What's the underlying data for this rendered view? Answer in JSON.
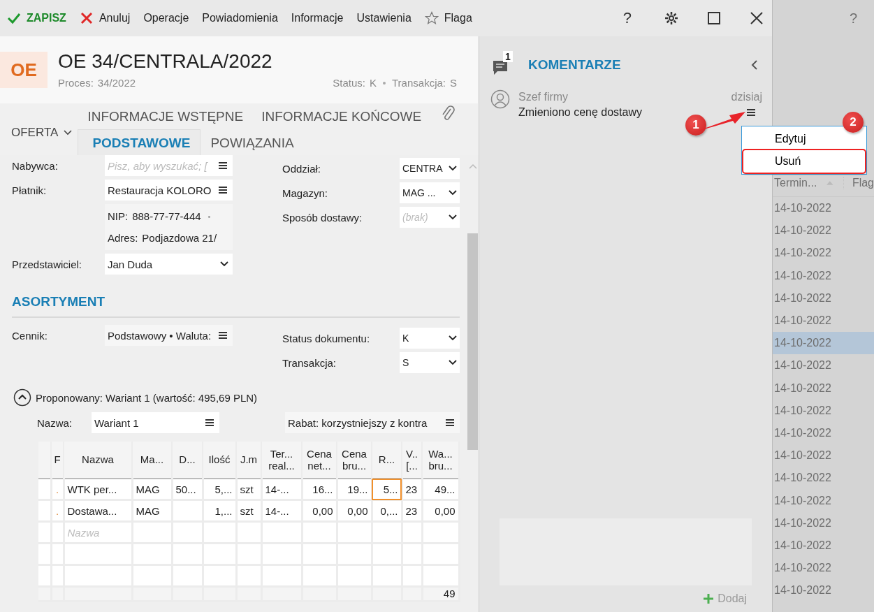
{
  "toolbar": {
    "items": [
      {
        "kind": "save",
        "label": "ZAPISZ"
      },
      {
        "kind": "cancel",
        "label": "Anuluj"
      },
      {
        "kind": "plain",
        "label": "Operacje"
      },
      {
        "kind": "plain",
        "label": "Powiadomienia"
      },
      {
        "kind": "plain",
        "label": "Informacje"
      },
      {
        "kind": "plain",
        "label": "Ustawienia"
      },
      {
        "kind": "flag",
        "label": "Flaga"
      }
    ],
    "help": "?"
  },
  "header": {
    "badge": "OE",
    "title": "OE 34/CENTRALA/2022",
    "process_label": "Proces:",
    "process": "34/2022",
    "status_label": "Status:",
    "status": "K",
    "transaction_label": "Transakcja:",
    "transaction": "S"
  },
  "document_type": "OFERTA",
  "tabs_top": [
    {
      "label": "INFORMACJE WSTĘPNE",
      "selected": false
    },
    {
      "label": "INFORMACJE KOŃCOWE",
      "selected": false
    }
  ],
  "tabs": [
    {
      "label": "PODSTAWOWE",
      "selected": true
    },
    {
      "label": "POWIĄZANIA",
      "selected": false
    }
  ],
  "fields_left": [
    {
      "kind": "menu",
      "label": "Nabywca:",
      "placeholder": "Pisz, aby wyszukać; ["
    },
    {
      "kind": "menu",
      "label": "Płatnik:",
      "value": "Restauracja KOLORO"
    },
    {
      "kind": "info",
      "lines": [
        {
          "label": "NIP:",
          "value": "888-77-77-444",
          "dot": "•"
        },
        {
          "label": "Adres:",
          "value": "Podjazdowa  21/"
        }
      ]
    },
    {
      "kind": "select",
      "label": "Przedstawiciel:",
      "value": "Jan Duda"
    }
  ],
  "fields_right": [
    {
      "kind": "select",
      "label": "Oddział:",
      "value": "CENTRA"
    },
    {
      "kind": "select",
      "label": "Magazyn:",
      "value": "MAG ..."
    },
    {
      "kind": "select",
      "label": "Sposób dostawy:",
      "placeholder": "(brak)"
    }
  ],
  "assortment": {
    "title": "ASORTYMENT",
    "price_list_label": "Cennik:",
    "price_list": "Podstawowy • Waluta:",
    "fields_right": [
      {
        "kind": "select",
        "label": "Status dokumentu:",
        "value": "K"
      },
      {
        "kind": "select",
        "label": "Transakcja:",
        "value": "S"
      }
    ],
    "variant": {
      "expanded": true,
      "summary": "Proponowany: Wariant 1 (wartość: 495,69 PLN)",
      "name_label": "Nazwa:",
      "name": "Wariant 1",
      "discount": "Rabat: korzystniejszy z kontra"
    }
  },
  "table": {
    "columns": [
      "",
      "F",
      "Nazwa",
      "Ma...",
      "D...",
      "Ilość",
      "J.m",
      "Ter...\nreal...",
      "Cena\nnet...",
      "Cena\nbru...",
      "R...",
      "V..\n[...",
      "Wa...\nbru..."
    ],
    "rows": [
      {
        "cells": [
          "",
          ".",
          "WTK per...",
          "MAG",
          "50...",
          "5,...",
          "szt",
          "14-...",
          "16...",
          "19...",
          "5...",
          "23",
          "49..."
        ],
        "focused": true
      },
      {
        "cells": [
          "",
          ".",
          "Dostawa...",
          "MAG",
          "",
          "1,...",
          "szt",
          "14-...",
          "0,00",
          "0,00",
          "0,...",
          "23",
          "0,00"
        ],
        "focused": false
      }
    ],
    "new_row_placeholder": "Nazwa",
    "footer_total": "49"
  },
  "comments": {
    "count": "1",
    "title": "KOMENTARZE",
    "items": [
      {
        "author": "Szef firmy",
        "date": "dzisiaj",
        "text": "Zmieniono cenę dostawy"
      }
    ],
    "menu": [
      {
        "label": "Edytuj",
        "selected": false
      },
      {
        "label": "Usuń",
        "selected": true
      }
    ],
    "callouts": [
      "1",
      "2"
    ],
    "add": "Dodaj"
  },
  "background_list": {
    "help": "?",
    "columns": [
      "Termin...",
      "Flag"
    ],
    "rows": [
      {
        "date": "14-10-2022",
        "selected": false
      },
      {
        "date": "14-10-2022",
        "selected": false
      },
      {
        "date": "14-10-2022",
        "selected": false
      },
      {
        "date": "14-10-2022",
        "selected": false
      },
      {
        "date": "14-10-2022",
        "selected": false
      },
      {
        "date": "14-10-2022",
        "selected": false
      },
      {
        "date": "14-10-2022",
        "selected": true
      },
      {
        "date": "14-10-2022",
        "selected": false
      },
      {
        "date": "14-10-2022",
        "selected": false
      },
      {
        "date": "14-10-2022",
        "selected": false
      },
      {
        "date": "14-10-2022",
        "selected": false
      },
      {
        "date": "14-10-2022",
        "selected": false
      },
      {
        "date": "14-10-2022",
        "selected": false
      },
      {
        "date": "14-10-2022",
        "selected": false
      },
      {
        "date": "14-10-2022",
        "selected": false
      },
      {
        "date": "14-10-2022",
        "selected": false
      },
      {
        "date": "14-10-2022",
        "selected": false
      },
      {
        "date": "14-10-2022",
        "selected": false
      }
    ]
  }
}
